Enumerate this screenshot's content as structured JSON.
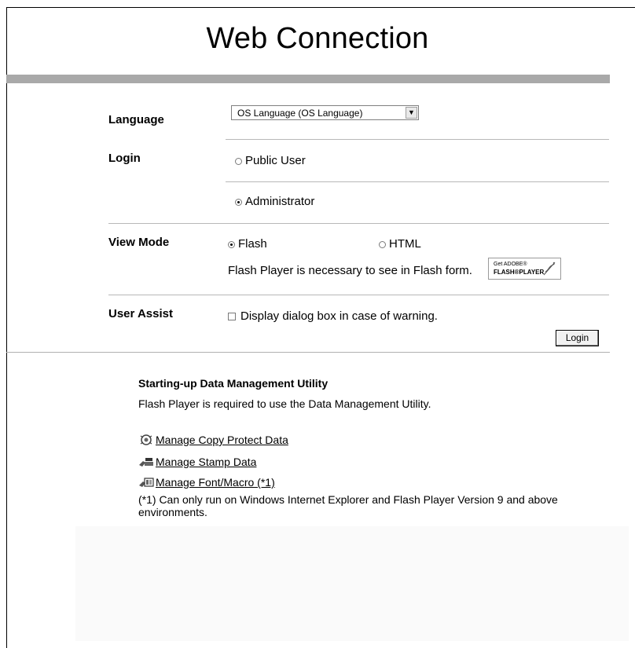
{
  "header": {
    "title": "Web Connection"
  },
  "form": {
    "language": {
      "label": "Language",
      "selected": "OS Language (OS Language)"
    },
    "login": {
      "label": "Login",
      "options": [
        "Public User",
        "Administrator"
      ],
      "selected": "Administrator"
    },
    "view_mode": {
      "label": "View Mode",
      "options": [
        "Flash",
        "HTML"
      ],
      "selected": "Flash",
      "note": "Flash Player is necessary to see in Flash form.",
      "badge_top": "Get ADOBE®",
      "badge_bottom": "FLASH®PLAYER"
    },
    "user_assist": {
      "label": "User Assist",
      "checkbox_label": "Display dialog box in case of warning.",
      "checked": false
    },
    "login_button": "Login"
  },
  "data_management": {
    "title": "Starting-up Data Management Utility",
    "description": "Flash Player is required to use the Data Management Utility.",
    "links": [
      {
        "label": "Manage Copy Protect Data",
        "icon": "copy-protect-icon"
      },
      {
        "label": "Manage Stamp Data",
        "icon": "stamp-icon"
      },
      {
        "label": "Manage Font/Macro (*1)",
        "icon": "font-macro-icon"
      }
    ],
    "note": "(*1) Can only run on Windows Internet Explorer and Flash Player Version 9 and above environments."
  },
  "colors": {
    "title_bar": "#a9a9a9",
    "divider": "#b8b8b8"
  }
}
